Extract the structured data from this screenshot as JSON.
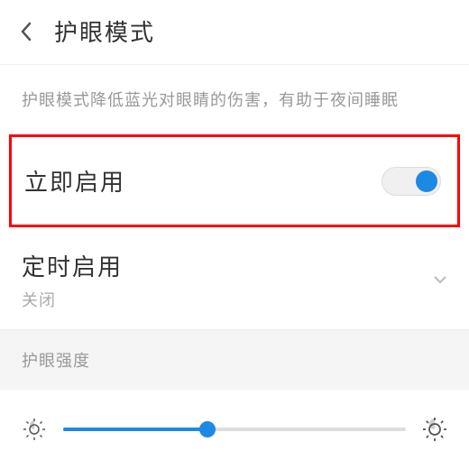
{
  "header": {
    "title": "护眼模式"
  },
  "description": "护眼模式降低蓝光对眼睛的伤害，有助于夜间睡眠",
  "enable_now": {
    "label": "立即启用",
    "toggle_on": true
  },
  "schedule": {
    "label": "定时启用",
    "status": "关闭"
  },
  "intensity": {
    "header": "护眼强度",
    "value_percent": 42
  },
  "colors": {
    "accent": "#1e88e5",
    "highlight_border": "#ff0000"
  }
}
